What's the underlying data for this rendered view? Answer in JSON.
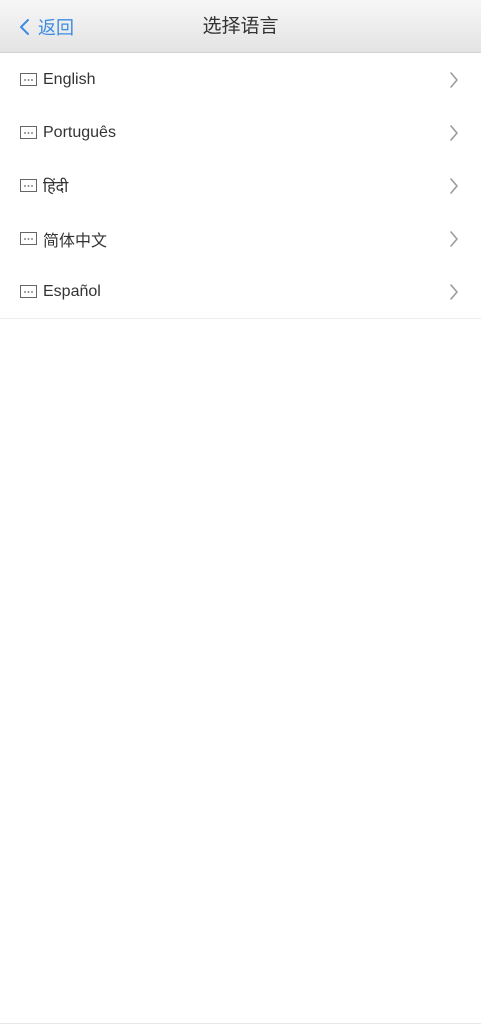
{
  "header": {
    "back_label": "返回",
    "title": "选择语言"
  },
  "languages": [
    {
      "label": "English"
    },
    {
      "label": "Português"
    },
    {
      "label": "हिंदी"
    },
    {
      "label": "简体中文"
    },
    {
      "label": "Español"
    }
  ],
  "colors": {
    "accent": "#3d8be5",
    "text": "#333333",
    "chevron": "#9b9b9b"
  },
  "icons": {
    "back": "chevron-left-icon",
    "item": "keyboard-icon",
    "disclosure": "chevron-right-icon"
  }
}
